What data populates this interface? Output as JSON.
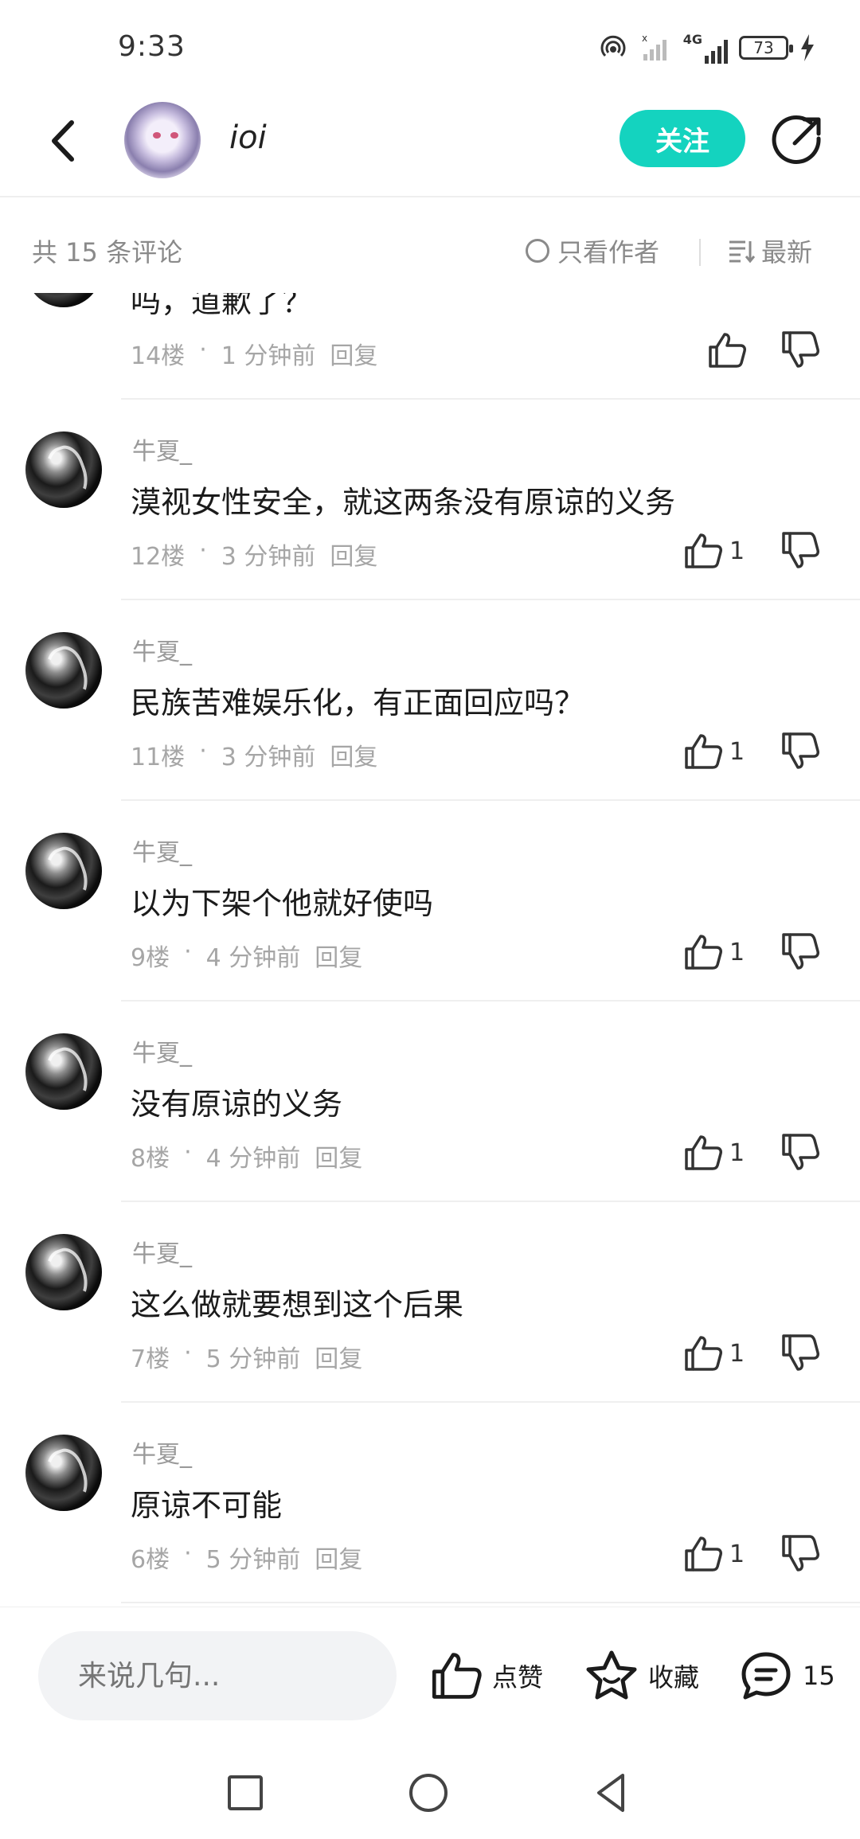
{
  "status_bar": {
    "time": "9:33",
    "network": "4G",
    "battery": "73"
  },
  "header": {
    "username": "ioi",
    "follow_label": "关注",
    "accent_color": "#14d3bf"
  },
  "filter": {
    "comment_count": "共 15 条评论",
    "author_only": "只看作者",
    "sort": "最新"
  },
  "comments": [
    {
      "user": "",
      "text": "吗，道歉了？",
      "floor": "14楼",
      "time": "1 分钟前",
      "reply": "回复",
      "likes": ""
    },
    {
      "user": "牛夏_",
      "text": "漠视女性安全，就这两条没有原谅的义务",
      "floor": "12楼",
      "time": "3 分钟前",
      "reply": "回复",
      "likes": "1"
    },
    {
      "user": "牛夏_",
      "text": "民族苦难娱乐化，有正面回应吗？",
      "floor": "11楼",
      "time": "3 分钟前",
      "reply": "回复",
      "likes": "1"
    },
    {
      "user": "牛夏_",
      "text": "以为下架个他就好使吗",
      "floor": "9楼",
      "time": "4 分钟前",
      "reply": "回复",
      "likes": "1"
    },
    {
      "user": "牛夏_",
      "text": "没有原谅的义务",
      "floor": "8楼",
      "time": "4 分钟前",
      "reply": "回复",
      "likes": "1"
    },
    {
      "user": "牛夏_",
      "text": "这么做就要想到这个后果",
      "floor": "7楼",
      "time": "5 分钟前",
      "reply": "回复",
      "likes": "1"
    },
    {
      "user": "牛夏_",
      "text": "原谅不可能",
      "floor": "6楼",
      "time": "5 分钟前",
      "reply": "回复",
      "likes": "1"
    }
  ],
  "bottom_bar": {
    "input_placeholder": "来说几句...",
    "like_label": "点赞",
    "favorite_label": "收藏",
    "comment_count": "15"
  }
}
